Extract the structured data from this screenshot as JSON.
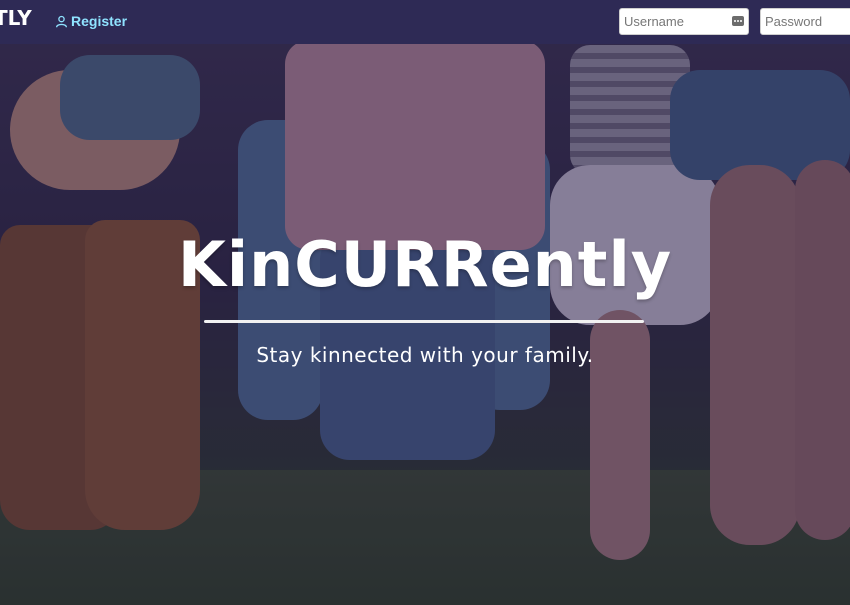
{
  "navbar": {
    "brand": "TLY",
    "register_label": "Register",
    "username_placeholder": "Username",
    "password_placeholder": "Password",
    "background_color": "#2e2a55",
    "link_color": "#8fe3ff"
  },
  "hero": {
    "title": "KinCURRently",
    "tagline": "Stay kinnected with your family.",
    "overlay_tint": "#261c46"
  },
  "icons": {
    "register": "user-icon",
    "username": "key-icon"
  }
}
